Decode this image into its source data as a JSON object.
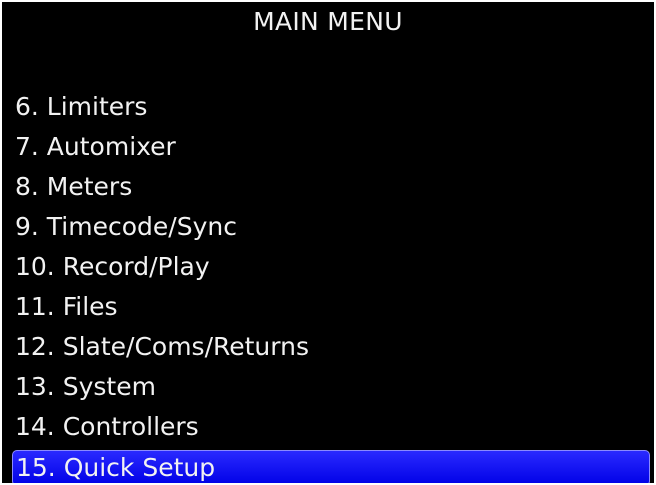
{
  "menu": {
    "title": "MAIN MENU",
    "items": [
      {
        "label": "6. Limiters",
        "selected": false
      },
      {
        "label": "7. Automixer",
        "selected": false
      },
      {
        "label": "8. Meters",
        "selected": false
      },
      {
        "label": "9. Timecode/Sync",
        "selected": false
      },
      {
        "label": "10. Record/Play",
        "selected": false
      },
      {
        "label": "11. Files",
        "selected": false
      },
      {
        "label": "12. Slate/Coms/Returns",
        "selected": false
      },
      {
        "label": "13. System",
        "selected": false
      },
      {
        "label": "14. Controllers",
        "selected": false
      },
      {
        "label": "15. Quick Setup",
        "selected": true
      }
    ]
  },
  "colors": {
    "background": "#000000",
    "text": "#f2f2f2",
    "selection": "#1414f5"
  }
}
